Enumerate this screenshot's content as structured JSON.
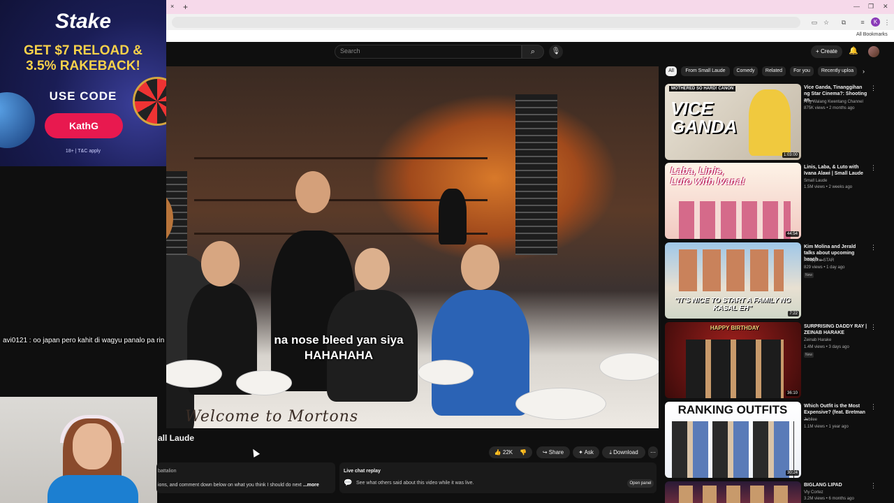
{
  "browser": {
    "tab_close": "×",
    "tab_new": "+",
    "profile_initial": "K",
    "all_bookmarks": "All Bookmarks"
  },
  "youtube": {
    "search_placeholder": "Search",
    "create_label": "Create",
    "video_title": "all Laude",
    "subtitle_line1": "na nose bleed yan siya",
    "subtitle_line2": "HAHAHAHA",
    "table_script": "Welcome to Mortons",
    "actions": {
      "like_count": "22K",
      "share": "Share",
      "ask": "Ask",
      "download": "Download"
    },
    "description": {
      "channel": "battalion",
      "text": "ions, and comment down below on what you think I should do next",
      "more": "...more"
    },
    "live_chat": {
      "title": "Live chat replay",
      "text": "See what others said about this video while it was live.",
      "open_panel": "Open panel"
    },
    "chips": [
      "All",
      "From Small Laude",
      "Comedy",
      "Related",
      "For you",
      "Recently uploa"
    ],
    "recommendations": [
      {
        "title": "Vice Ganda, Tinanggihan ng Star Cinema?: Shooting an...",
        "channel": "Ang Walang Kwentang Channel",
        "meta": "875K views • 2 months ago",
        "duration": "1:03:00",
        "thumb_text": "VICE GANDA",
        "thumb_top": "MOTHERED SO HARD! CANON",
        "new": ""
      },
      {
        "title": "Linis, Laba, & Luto with Ivana Alawi | Small Laude",
        "channel": "Small Laude",
        "meta": "1.5M views • 2 weeks ago",
        "duration": "44:54",
        "thumb_text": "Laba, Linis, Luto with Ivana!",
        "thumb_top": "",
        "new": ""
      },
      {
        "title": "Kim Molina and Jerald talks about upcoming beach ...",
        "channel": "Philippine STAR",
        "meta": "829 views • 1 day ago",
        "duration": "7:22",
        "thumb_text": "\"IT'S NICE TO START A FAMILY NG KASAL EH\"",
        "thumb_top": "",
        "new": "New"
      },
      {
        "title": "SURPRISING DADDY RAY | ZEINAB HARAKE",
        "channel": "Zeinab Harake",
        "meta": "1.4M views • 3 days ago",
        "duration": "36:10",
        "thumb_text": "HAPPY BIRTHDAY",
        "thumb_top": "",
        "new": "New"
      },
      {
        "title": "Which Outfit is the Most Expensive? (feat. Bretman ...",
        "channel": "Jubilee",
        "meta": "1.1M views • 1 year ago",
        "duration": "30:24",
        "thumb_text": "RANKING OUTFITS",
        "thumb_top": "",
        "new": ""
      },
      {
        "title": "BIGLANG LIPAD",
        "channel": "Vly Cortez",
        "meta": "3.2M views • 6 months ago",
        "duration": "",
        "thumb_text": "",
        "thumb_top": "",
        "new": ""
      }
    ]
  },
  "stream": {
    "ad": {
      "logo": "Stake",
      "headline1": "GET $7 RELOAD &",
      "headline2": "3.5% RAKEBACK!",
      "use_code": "USE CODE",
      "code": "KathG",
      "terms": "18+ | T&C apply"
    },
    "chat_message": "avi0121 : oo japan pero kahit di wagyu panalo pa rin"
  }
}
